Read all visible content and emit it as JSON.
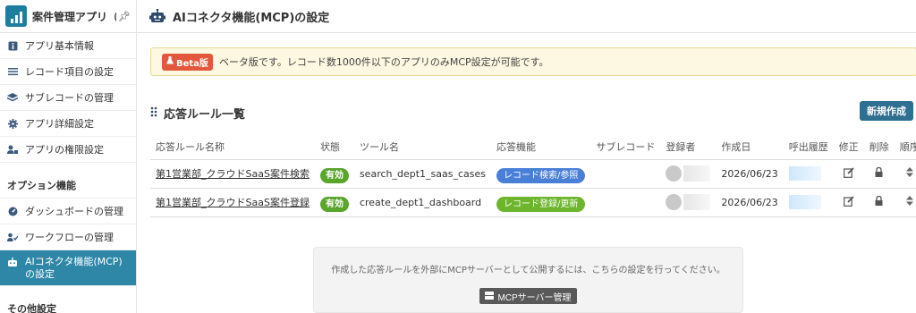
{
  "sidebar": {
    "app_title": "案件管理アプリ（第·",
    "pin_icon": "pin-icon",
    "items": [
      {
        "label": "アプリ基本情報",
        "icon": "info-icon"
      },
      {
        "label": "レコード項目の設定",
        "icon": "list-icon"
      },
      {
        "label": "サブレコードの管理",
        "icon": "layers-icon"
      },
      {
        "label": "アプリ詳細設定",
        "icon": "gear-icon"
      },
      {
        "label": "アプリの権限設定",
        "icon": "user-lock-icon"
      }
    ],
    "option_section": "オプション機能",
    "option_items": [
      {
        "label": "ダッシュボードの管理",
        "icon": "dashboard-icon"
      },
      {
        "label": "ワークフローの管理",
        "icon": "workflow-icon"
      },
      {
        "label": "AIコネクタ機能(MCP)の設定",
        "icon": "robot-icon",
        "active": true
      }
    ],
    "other_section": "その他設定"
  },
  "header": {
    "title": "AIコネクタ機能(MCP)の設定"
  },
  "beta_notice": {
    "badge": "Beta版",
    "text": "ベータ版です。レコード数1000件以下のアプリのみMCP設定が可能です。"
  },
  "rules_section": {
    "title": "応答ルール一覧",
    "new_button": "新規作成"
  },
  "table": {
    "columns": [
      "応答ルール名称",
      "状態",
      "ツール名",
      "応答機能",
      "サブレコード",
      "登録者",
      "作成日",
      "呼出履歴",
      "修正",
      "削除",
      "順序"
    ],
    "rows": [
      {
        "name": "第1営業部_クラウドSaaS案件検索",
        "status": "有効",
        "tool": "search_dept1_saas_cases",
        "function": "レコード検索/参照",
        "function_color": "#4a7fd8",
        "subrecord": "",
        "created": "2026/06/23"
      },
      {
        "name": "第1営業部_クラウドSaaS案件登録",
        "status": "有効",
        "tool": "create_dept1_dashboard",
        "function": "レコード登録/更新",
        "function_color": "#6db52d",
        "subrecord": "",
        "created": "2026/06/23"
      }
    ]
  },
  "mcp_info": {
    "text": "作成した応答ルールを外部にMCPサーバーとして公開するには、こちらの設定を行ってください。",
    "button": "MCPサーバー管理"
  }
}
